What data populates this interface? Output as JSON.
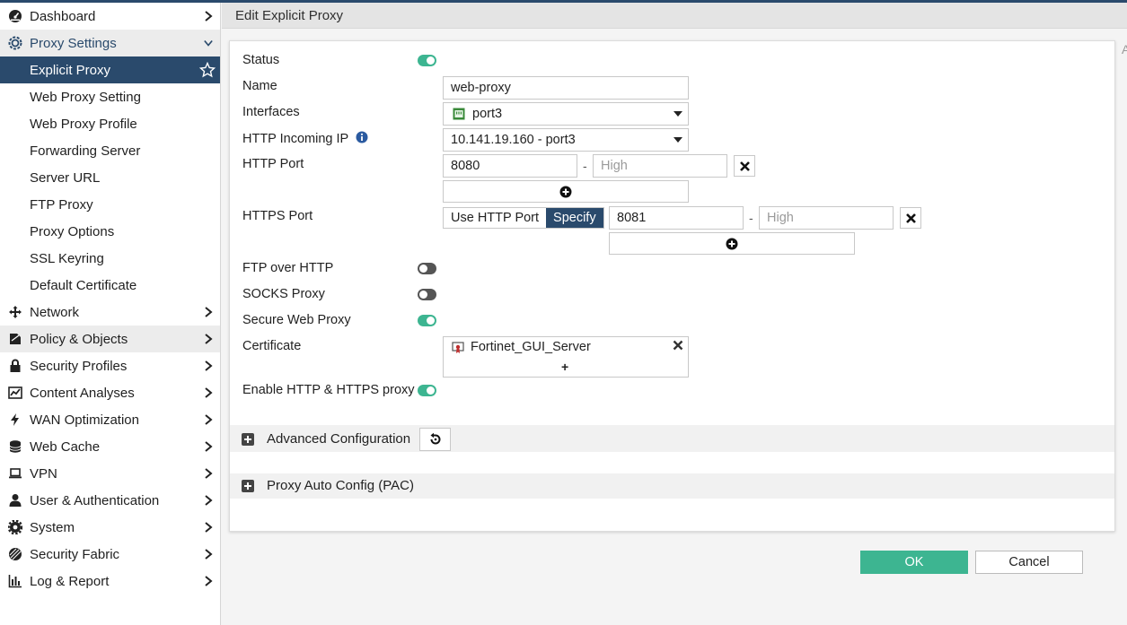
{
  "sidebar": {
    "items": [
      {
        "label": "Dashboard",
        "icon": "dashboard-icon"
      },
      {
        "label": "Proxy Settings",
        "icon": "gear-icon"
      },
      {
        "label": "Network",
        "icon": "network-icon"
      },
      {
        "label": "Policy & Objects",
        "icon": "policy-icon"
      },
      {
        "label": "Security Profiles",
        "icon": "lock-icon"
      },
      {
        "label": "Content Analyses",
        "icon": "chart-icon"
      },
      {
        "label": "WAN Optimization",
        "icon": "bolt-icon"
      },
      {
        "label": "Web Cache",
        "icon": "database-icon"
      },
      {
        "label": "VPN",
        "icon": "laptop-icon"
      },
      {
        "label": "User & Authentication",
        "icon": "user-icon"
      },
      {
        "label": "System",
        "icon": "gear-icon"
      },
      {
        "label": "Security Fabric",
        "icon": "fabric-icon"
      },
      {
        "label": "Log & Report",
        "icon": "bar-chart-icon"
      }
    ],
    "sub_items": [
      "Explicit Proxy",
      "Web Proxy Setting",
      "Web Proxy Profile",
      "Forwarding Server",
      "Server URL",
      "FTP Proxy",
      "Proxy Options",
      "SSL Keyring",
      "Default Certificate"
    ]
  },
  "page": {
    "title": "Edit Explicit Proxy",
    "edge_text": "A"
  },
  "form": {
    "status_label": "Status",
    "status_on": true,
    "name_label": "Name",
    "name_value": "web-proxy",
    "interfaces_label": "Interfaces",
    "interfaces_value": "port3",
    "incoming_ip_label": "HTTP Incoming IP",
    "incoming_ip_value": "10.141.19.160 - port3",
    "http_port_label": "HTTP Port",
    "http_port_value": "8080",
    "high_placeholder": "High",
    "https_port_label": "HTTPS Port",
    "https_opt_use_http": "Use HTTP Port",
    "https_opt_specify": "Specify",
    "https_port_value": "8081",
    "ftp_over_http_label": "FTP over HTTP",
    "ftp_over_http_on": false,
    "socks_proxy_label": "SOCKS Proxy",
    "socks_proxy_on": false,
    "secure_web_proxy_label": "Secure Web Proxy",
    "secure_web_proxy_on": true,
    "certificate_label": "Certificate",
    "certificate_value": "Fortinet_GUI_Server",
    "certificate_add": "+",
    "enable_http_https_label": "Enable HTTP & HTTPS proxy",
    "enable_http_https_on": true,
    "dash": "-"
  },
  "sections": {
    "advanced": "Advanced Configuration",
    "pac": "Proxy Auto Config (PAC)"
  },
  "footer": {
    "ok": "OK",
    "cancel": "Cancel"
  },
  "colors": {
    "nav_dark": "#2a4a6c",
    "toggle_on": "#3db591",
    "ok_button": "#3db591"
  }
}
